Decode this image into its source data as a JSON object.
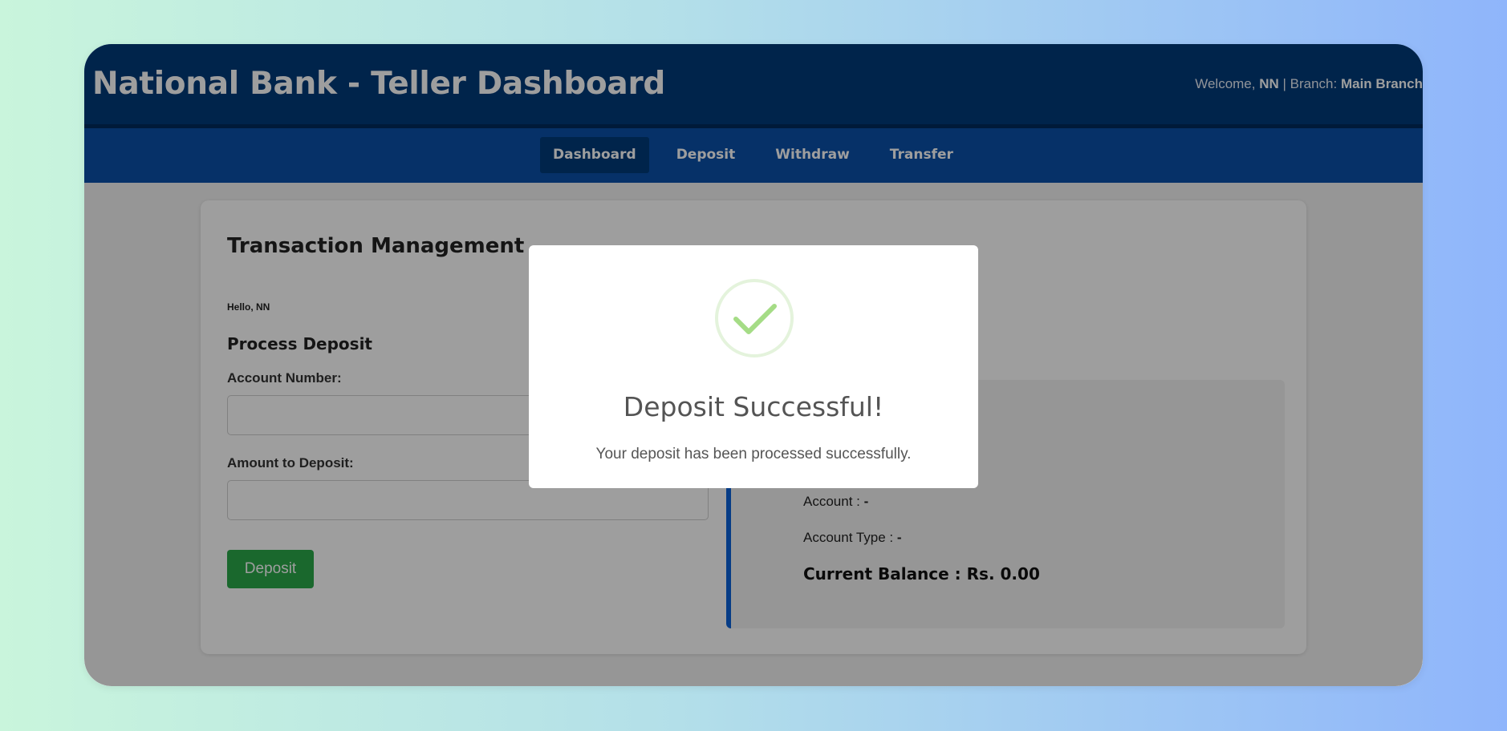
{
  "header": {
    "title": "National Bank - Teller Dashboard",
    "welcome_prefix": "Welcome, ",
    "user": "NN",
    "branch_prefix": " | Branch: ",
    "branch": "Main Branch"
  },
  "nav": {
    "items": [
      {
        "label": "Dashboard",
        "active": true
      },
      {
        "label": "Deposit"
      },
      {
        "label": "Withdraw"
      },
      {
        "label": "Transfer"
      }
    ]
  },
  "main": {
    "title": "Transaction Management",
    "greeting": "Hello, NN",
    "section_title": "Process Deposit",
    "account_label": "Account Number:",
    "account_value": "",
    "amount_label": "Amount to Deposit:",
    "amount_value": "",
    "deposit_button": "Deposit"
  },
  "account_info": {
    "account_label": "Account : ",
    "account_value": "-",
    "type_label": "Account Type : ",
    "type_value": "-",
    "balance_label": "Current Balance : Rs. ",
    "balance_value": "0.00"
  },
  "modal": {
    "icon": "checkmark-icon",
    "title": "Deposit Successful!",
    "message": "Your deposit has been processed successfully.",
    "accent": "#a5dc86"
  }
}
